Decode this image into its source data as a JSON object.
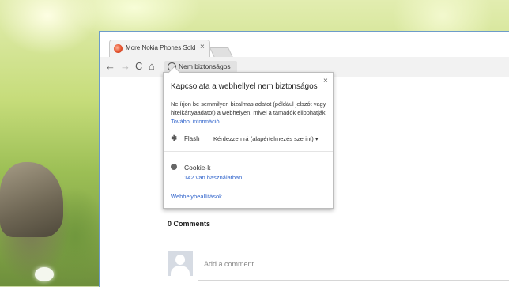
{
  "tab": {
    "title": "More Nokia Phones Sold",
    "close": "×"
  },
  "toolbar": {
    "back": "←",
    "forward": "→",
    "reload": "C",
    "home": "⌂",
    "security_chip": "Nem biztonságos",
    "info": "i"
  },
  "popup": {
    "close": "×",
    "title": "Kapcsolata a webhellyel nem biztonságos",
    "body": "Ne írjon be semmilyen bizalmas adatot (például jelszót vagy hitelkártyaadatot) a webhelyen, mivel a támadók ellophatják.",
    "more_info": "További információ",
    "flash_label": "Flash",
    "flash_value": "Kérdezzen rá (alapértelmezés szerint)",
    "dropdown_arrow": "▾",
    "cookies_label": "Cookie-k",
    "cookies_sub": "142 van használatban",
    "site_settings": "Webhelybeállítások"
  },
  "comments": {
    "title": "0 Comments",
    "placeholder": "Add a comment..."
  },
  "icons": {
    "puzzle": "puzzle-icon",
    "cookie": "cookie-icon",
    "info": "info-icon"
  }
}
